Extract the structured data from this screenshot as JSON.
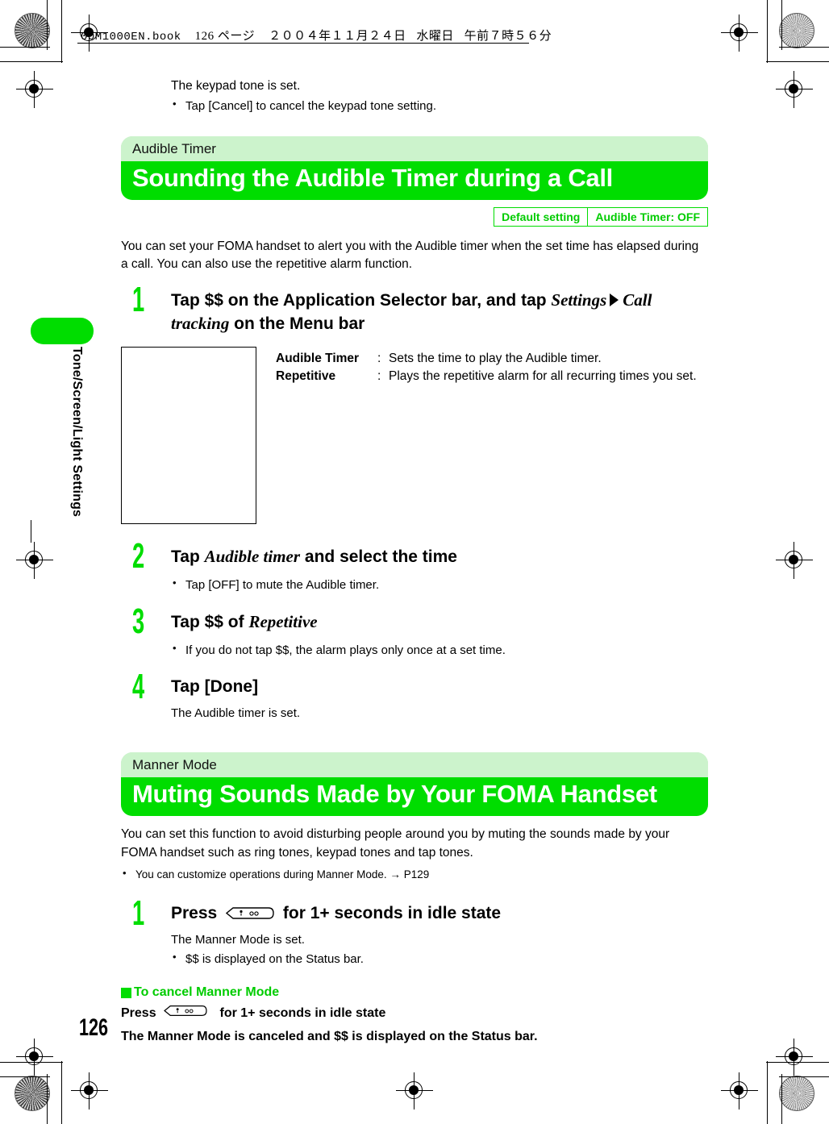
{
  "print_header": {
    "filename": "00M1000EN.book",
    "page_marker": "126 ページ",
    "date": "２００４年１１月２４日",
    "weekday": "水曜日",
    "time": "午前７時５６分"
  },
  "side_tab": {
    "label": "Tone/Screen/Light Settings"
  },
  "page_number": "126",
  "intro": {
    "line1": "The keypad tone is set.",
    "bullets": [
      "Tap [Cancel] to cancel the keypad tone setting."
    ]
  },
  "sections": [
    {
      "category": "Audible Timer",
      "title": "Sounding the Audible Timer during a Call",
      "default_setting": {
        "label": "Default setting",
        "value": "Audible Timer: OFF"
      },
      "description": "You can set your FOMA handset to alert you with the Audible timer when the set time has elapsed during a call. You can also use the repetitive alarm function.",
      "steps": [
        {
          "num": "1",
          "head_part1": "Tap $$ on the Application Selector bar, and tap ",
          "head_ui1": "Settings",
          "head_ui2": "Call tracking",
          "head_part2": " on the Menu bar"
        },
        {
          "num": "2",
          "head_part1": "Tap ",
          "head_ui1": "Audible timer",
          "head_part2": " and select the time",
          "bullets": [
            "Tap [OFF] to mute the Audible timer."
          ]
        },
        {
          "num": "3",
          "head_part1": "Tap $$ of ",
          "head_ui1": "Repetitive",
          "head_part2": "",
          "bullets": [
            "If you do not tap $$, the alarm plays only once at a set time."
          ]
        },
        {
          "num": "4",
          "head_part1": "Tap [Done]",
          "head_ui1": "",
          "head_part2": "",
          "after_text": "The Audible timer is set."
        }
      ],
      "desc_table": [
        {
          "key": "Audible Timer",
          "colon": ":",
          "value": "Sets the time to play the Audible timer."
        },
        {
          "key": "Repetitive",
          "colon": ":",
          "value": "Plays the repetitive alarm for all recurring times you set."
        }
      ]
    },
    {
      "category": "Manner Mode",
      "title": "Muting Sounds Made by Your FOMA Handset",
      "description": "You can set this function to avoid disturbing people around you by muting the sounds made by your FOMA handset such as ring tones, keypad tones and tap tones.",
      "bullets": [
        "You can customize operations during Manner Mode. → P129"
      ],
      "steps": [
        {
          "num": "1",
          "head_part1": "Press ",
          "head_icon": "phone-key-icon",
          "head_part2": " for 1+ seconds in idle state",
          "after_text": "The Manner Mode is set.",
          "bullets": [
            "$$ is displayed on the Status bar."
          ]
        }
      ],
      "subsection": {
        "heading": "To cancel Manner Mode",
        "line1_part1": "Press ",
        "line1_icon": "phone-key-icon",
        "line1_part2": " for 1+ seconds in idle state",
        "line2": "The Manner Mode is canceled and $$ is displayed on the Status bar."
      }
    }
  ],
  "colors": {
    "brand_green": "#00dd00",
    "light_green": "#ccf3cc",
    "text_green": "#00cc00"
  }
}
